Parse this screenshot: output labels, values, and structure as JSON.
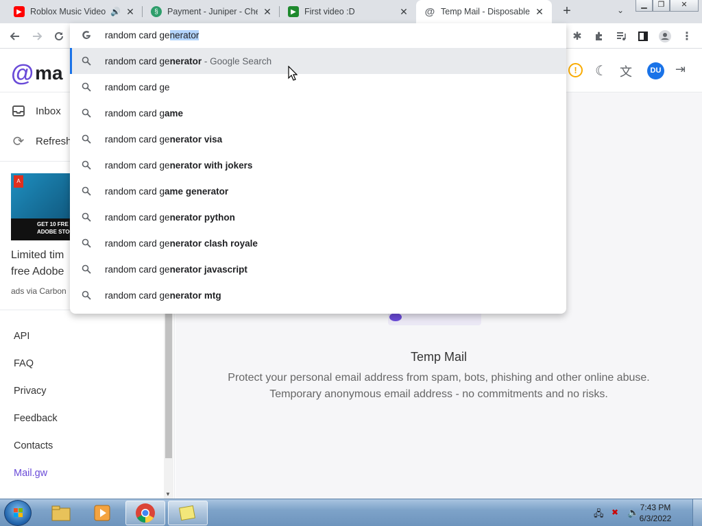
{
  "browser": {
    "tabs": [
      {
        "title": "Roblox Music Video",
        "favicon": "youtube-icon",
        "active": false
      },
      {
        "title": "Payment - Juniper - Chec",
        "favicon": "juniper-icon",
        "active": false
      },
      {
        "title": "First video :D",
        "favicon": "video-icon",
        "active": false
      },
      {
        "title": "Temp Mail - Disposable T",
        "favicon": "at-sign-icon",
        "active": true
      }
    ],
    "omnibox": {
      "typed": "random card ge",
      "autocomplete": "nerator"
    },
    "suggestions": [
      {
        "plain": "random card ge",
        "bold": "nerator",
        "suffix": " - Google Search"
      },
      {
        "plain": "random card ge",
        "bold": "",
        "suffix": ""
      },
      {
        "plain": "random card g",
        "bold": "ame",
        "suffix": ""
      },
      {
        "plain": "random card ge",
        "bold": "nerator visa",
        "suffix": ""
      },
      {
        "plain": "random card ge",
        "bold": "nerator with jokers",
        "suffix": ""
      },
      {
        "plain": "random card g",
        "bold": "ame generator",
        "suffix": ""
      },
      {
        "plain": "random card ge",
        "bold": "nerator python",
        "suffix": ""
      },
      {
        "plain": "random card ge",
        "bold": "nerator clash royale",
        "suffix": ""
      },
      {
        "plain": "random card ge",
        "bold": "nerator javascript",
        "suffix": ""
      },
      {
        "plain": "random card ge",
        "bold": "nerator mtg",
        "suffix": ""
      }
    ]
  },
  "site": {
    "logo_text": "ma",
    "avatar_initials": "DU",
    "nav": {
      "inbox": "Inbox",
      "refresh": "Refresh"
    },
    "ad": {
      "banner_line1": "GET 10 FRE",
      "banner_line2": "ADOBE STOCK I",
      "text_line1": "Limited tim",
      "text_line2": "free Adobe",
      "via": "ads via Carbon"
    },
    "links": [
      "API",
      "FAQ",
      "Privacy",
      "Feedback",
      "Contacts",
      "Mail.gw"
    ],
    "hero": {
      "title": "Temp Mail",
      "line1": "Protect your personal email address from spam, bots, phishing and other online abuse.",
      "line2": "Temporary anonymous email address - no commitments and no risks."
    }
  },
  "taskbar": {
    "time": "7:43 PM",
    "date": "6/3/2022"
  },
  "colors": {
    "accent": "#1a73e8",
    "brand": "#6a4bd8",
    "avatar": "#1a73e8",
    "warning": "#f9ab00"
  }
}
